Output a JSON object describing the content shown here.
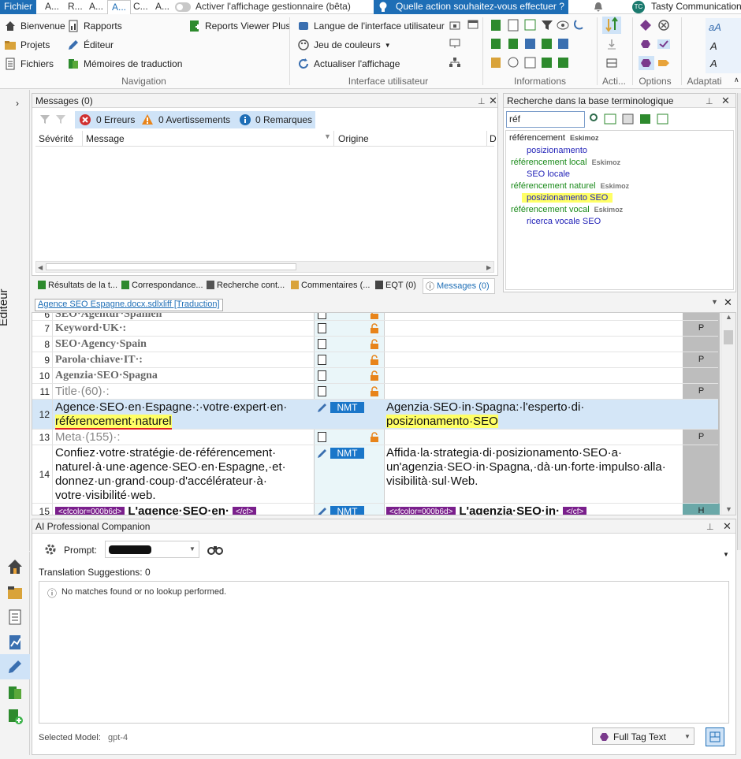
{
  "tabs": [
    "Fichier",
    "A...",
    "R...",
    "A...",
    "A...",
    "C...",
    "A..."
  ],
  "toggle_label": "Activer l'affichage gestionnaire (bêta)",
  "search_prompt": "Quelle action souhaitez-vous effectuer ?",
  "user": {
    "initials": "TC",
    "name": "Tasty Communication"
  },
  "ribbon": {
    "nav": {
      "welcome": "Bienvenue",
      "projects": "Projets",
      "files": "Fichiers",
      "reports": "Rapports",
      "editor": "Éditeur",
      "tm": "Mémoires de traduction",
      "rvp": "Reports Viewer Plus",
      "group": "Navigation"
    },
    "ui": {
      "lang": "Langue de l'interface utilisateur",
      "colors": "Jeu de couleurs",
      "refresh": "Actualiser l'affichage",
      "group": "Interface utilisateur"
    },
    "info_group": "Informations",
    "actions_group": "Acti...",
    "options_group": "Options",
    "adapt_group": "Adaptati"
  },
  "messages": {
    "title": "Messages (0)",
    "errors": "0 Erreurs",
    "warnings": "0 Avertissements",
    "notes": "0 Remarques",
    "col_severity": "Sévérité",
    "col_message": "Message",
    "col_origin": "Origine",
    "col_d": "D"
  },
  "bottom_tabs": [
    "Résultats de la t...",
    "Correspondance...",
    "Recherche cont...",
    "Commentaires (...",
    "EQT (0)",
    "Messages (0)"
  ],
  "termbase": {
    "title": "Recherche dans la base terminologique",
    "query": "réf",
    "entries": [
      {
        "src": "référencement",
        "db": "Eskimoz",
        "tgt": "posizionamento",
        "hl": false
      },
      {
        "src": "référencement local",
        "db": "Eskimoz",
        "tgt": "SEO locale",
        "hl": false
      },
      {
        "src": "référencement naturel",
        "db": "Eskimoz",
        "tgt": "posizionamento SEO",
        "hl": true
      },
      {
        "src": "référencement vocal",
        "db": "Eskimoz",
        "tgt": "ricerca vocale SEO",
        "hl": false
      }
    ]
  },
  "doc_tab": "Agence SEO Espagne.docx.sdlxliff [Traduction]",
  "side_label": "Éditeur",
  "segments": [
    {
      "n": "6",
      "src": "SEO·Agentur·Spanien",
      "pc": ""
    },
    {
      "n": "7",
      "src": "Keyword·UK·:",
      "pc": "P"
    },
    {
      "n": "8",
      "src": "SEO·Agency·Spain",
      "pc": ""
    },
    {
      "n": "9",
      "src": "Parola·chiave·IT·:",
      "pc": "P"
    },
    {
      "n": "10",
      "src": "Agenzia·SEO·Spagna",
      "pc": ""
    },
    {
      "n": "11",
      "src": "Title·(60)·:",
      "pc": "P"
    },
    {
      "n": "12",
      "src1": "Agence·SEO·en·Espagne·:·votre·expert·en·",
      "src2": "référencement·naturel",
      "tgt1": "Agenzia·SEO·in·Spagna:·l'esperto·di·",
      "tgt2": "posizionamento·SEO",
      "status": "NMT"
    },
    {
      "n": "13",
      "src": "Meta·(155)·:",
      "pc": "P"
    },
    {
      "n": "14",
      "src": "Confiez·votre·stratégie·de·référencement· naturel·à·une·agence·SEO·en·Espagne,·et· donnez·un·grand·coup·d'accélérateur·à· votre·visibilité·web.",
      "tgt": "Affida·la·strategia·di·posizionamento·SEO·a· un'agenzia·SEO·in·Spagna,·dà·un·forte·impulso·alla· visibilità·sul·Web.",
      "status": "NMT"
    },
    {
      "n": "15",
      "tag_open": "<cfcolor=000b6d>",
      "src": "L'agence·SEO·en·",
      "tag_close": "</cf>",
      "tgt": "L'agenzia·SEO·in·",
      "status": "NMT",
      "pc": "H"
    }
  ],
  "companion": {
    "title": "AI Professional Companion",
    "prompt_label": "Prompt:",
    "suggestions": "Translation Suggestions: 0",
    "no_matches": "No matches found or no lookup performed.",
    "model_label": "Selected Model:",
    "model": "gpt-4",
    "full_tag": "Full Tag Text"
  }
}
